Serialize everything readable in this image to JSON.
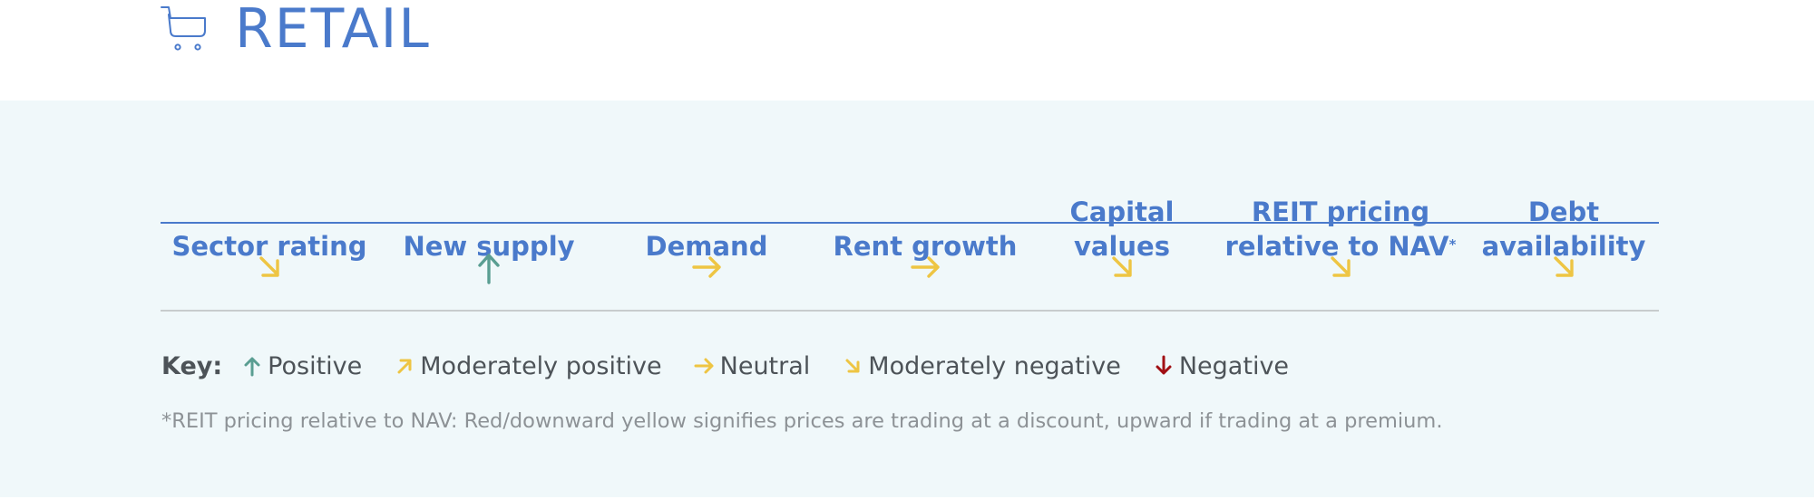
{
  "header": {
    "icon": "shopping-cart-icon",
    "title": "RETAIL"
  },
  "colors": {
    "accent_blue": "#4a7acb",
    "positive_green": "#5a9e92",
    "moderate_yellow": "#eec543",
    "negative_red": "#a10f14",
    "text_dark": "#4d5358",
    "text_muted": "#8d9296",
    "panel_bg": "#f0f8fa"
  },
  "table": {
    "columns": [
      {
        "line1": "",
        "line2": "Sector rating",
        "sup": "",
        "rating": "moderately-negative",
        "icon": "arrow-down-right-icon"
      },
      {
        "line1": "",
        "line2": "New supply",
        "sup": "",
        "rating": "positive",
        "icon": "arrow-up-icon"
      },
      {
        "line1": "",
        "line2": "Demand",
        "sup": "",
        "rating": "neutral",
        "icon": "arrow-right-icon"
      },
      {
        "line1": "",
        "line2": "Rent growth",
        "sup": "",
        "rating": "neutral",
        "icon": "arrow-right-icon"
      },
      {
        "line1": "Capital",
        "line2": "values",
        "sup": "",
        "rating": "moderately-negative",
        "icon": "arrow-down-right-icon"
      },
      {
        "line1": "REIT pricing",
        "line2": "relative to NAV",
        "sup": "*",
        "rating": "moderately-negative",
        "icon": "arrow-down-right-icon"
      },
      {
        "line1": "Debt",
        "line2": "availability",
        "sup": "",
        "rating": "moderately-negative",
        "icon": "arrow-down-right-icon"
      }
    ]
  },
  "key": {
    "label": "Key:",
    "items": [
      {
        "rating": "positive",
        "label": "Positive",
        "icon": "arrow-up-icon"
      },
      {
        "rating": "moderately-positive",
        "label": "Moderately positive",
        "icon": "arrow-up-right-icon"
      },
      {
        "rating": "neutral",
        "label": "Neutral",
        "icon": "arrow-right-icon"
      },
      {
        "rating": "moderately-negative",
        "label": "Moderately negative",
        "icon": "arrow-down-right-icon"
      },
      {
        "rating": "negative",
        "label": "Negative",
        "icon": "arrow-down-icon"
      }
    ]
  },
  "footnote": "*REIT pricing relative to NAV: Red/downward yellow signifies prices are trading at a discount, upward if trading at a premium."
}
